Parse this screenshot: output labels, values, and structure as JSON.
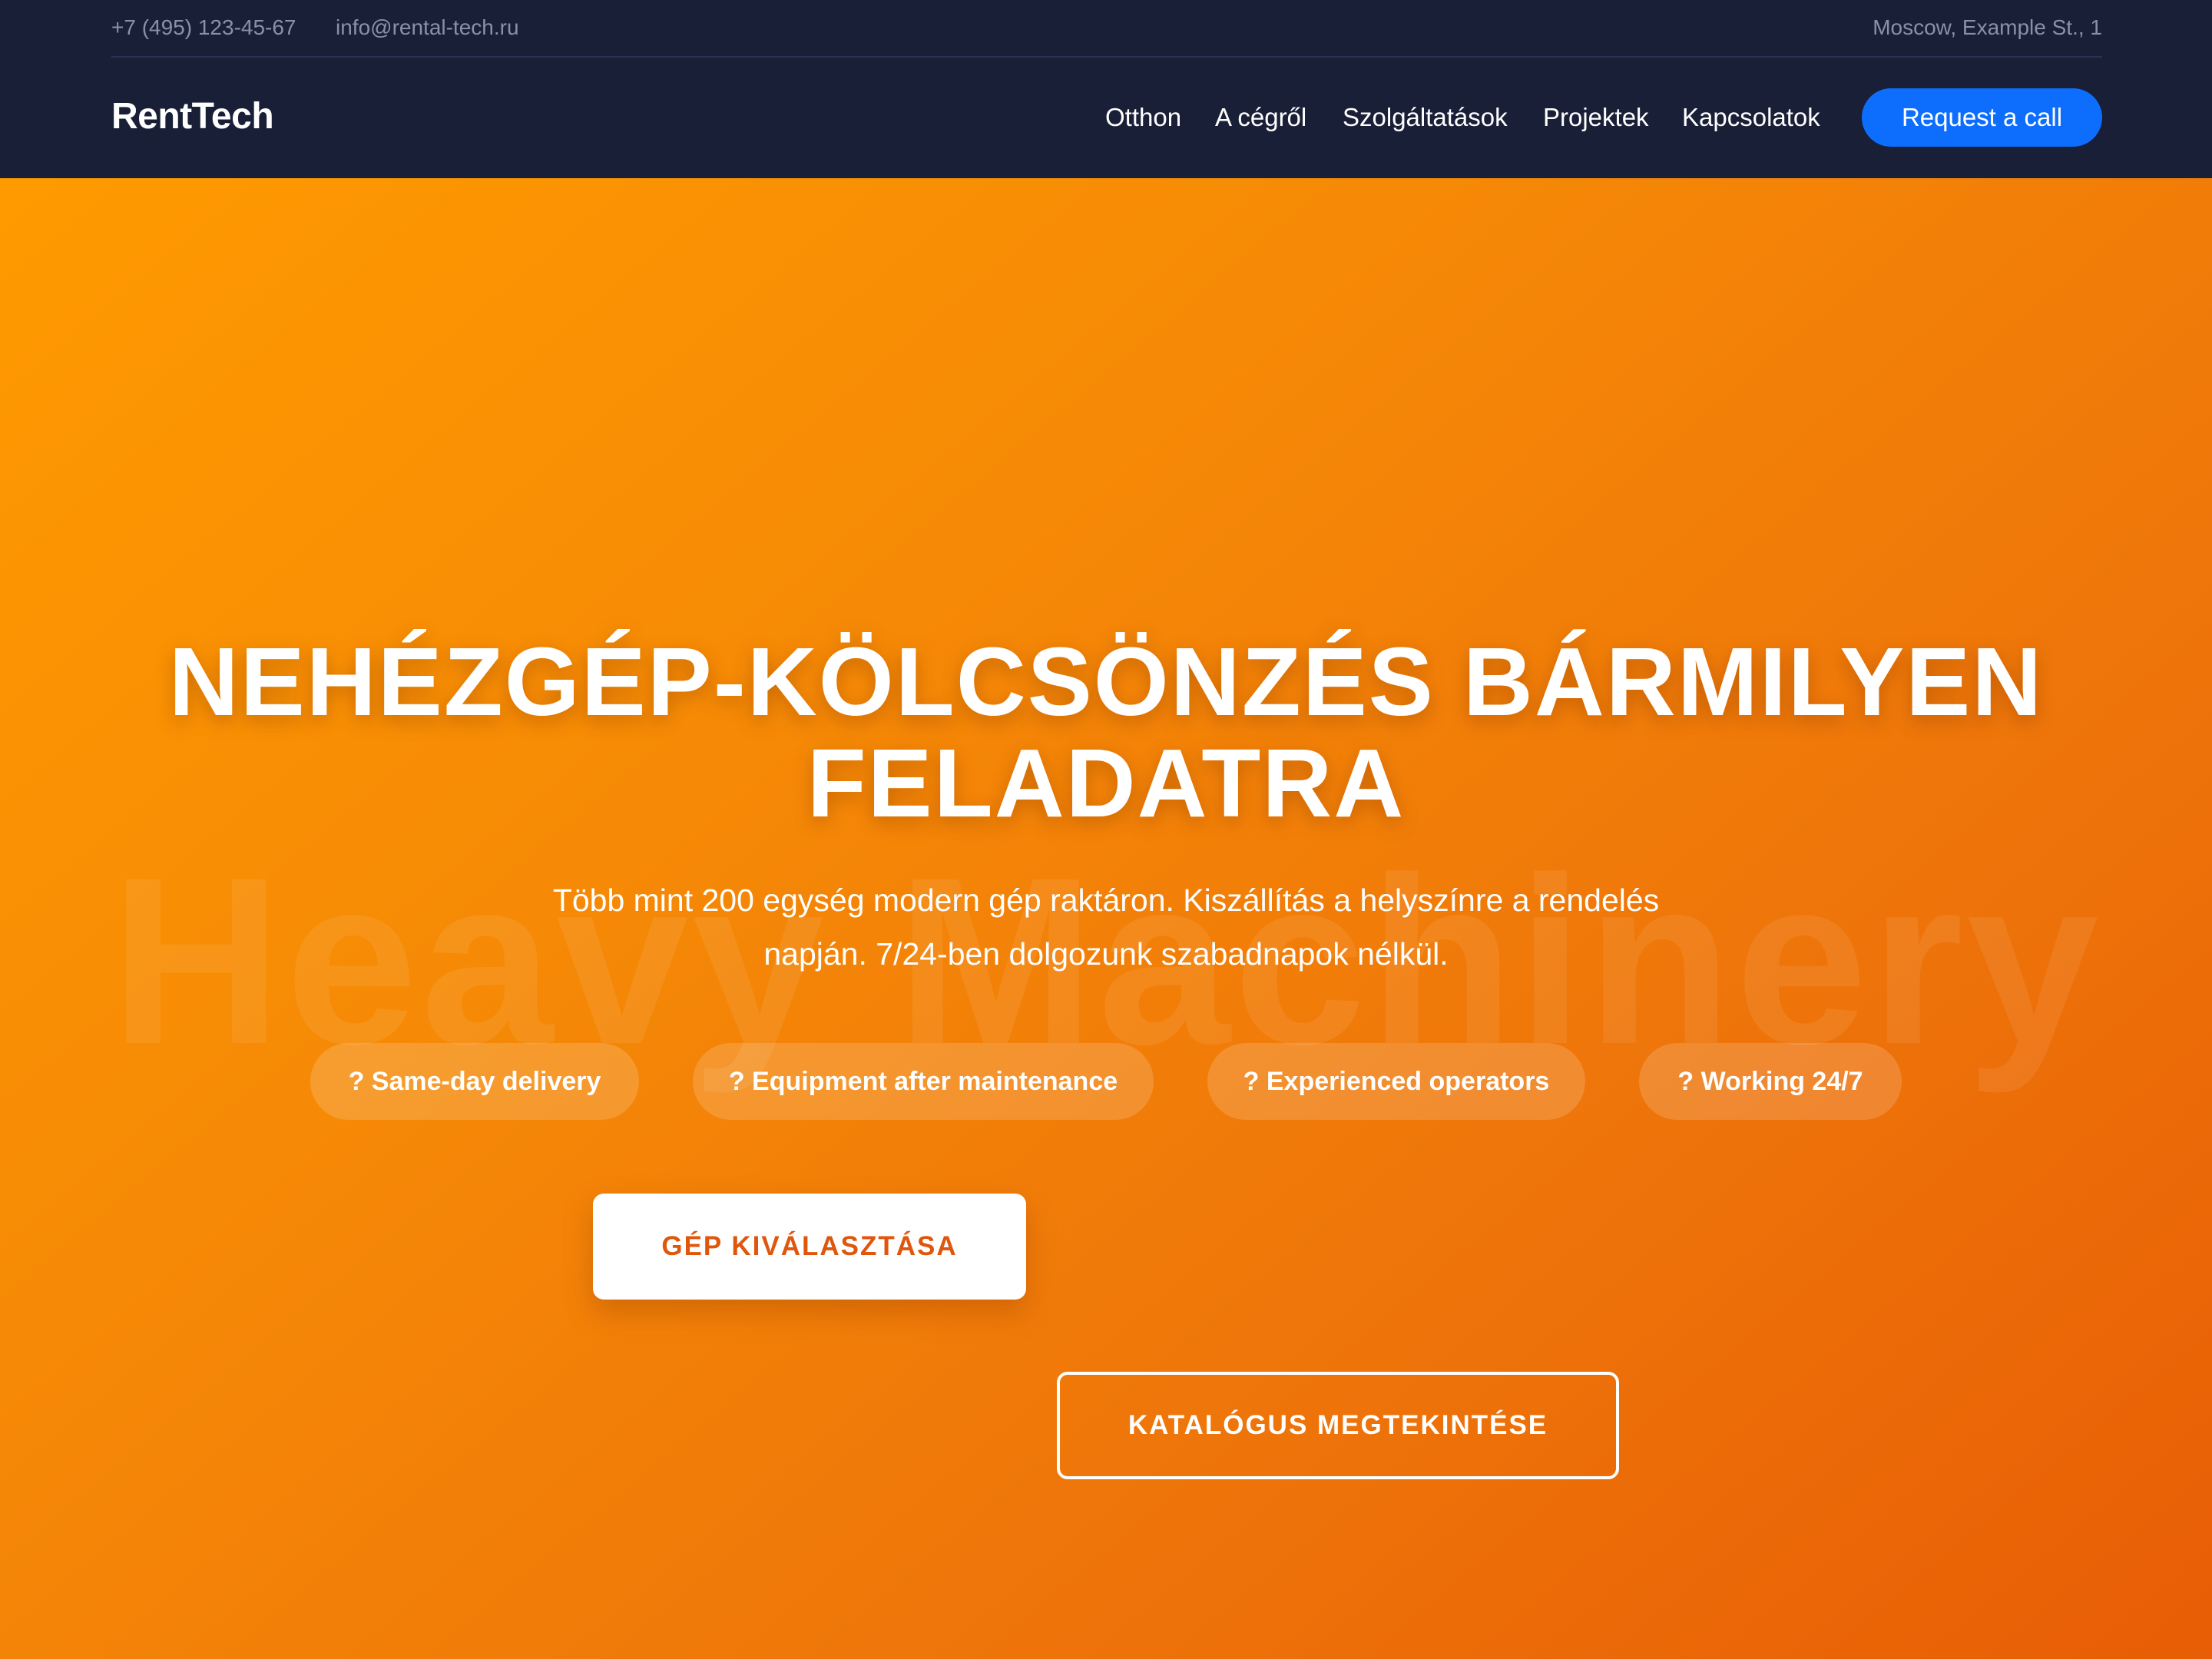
{
  "topbar": {
    "phone": "+7 (495) 123-45-67",
    "email": "info@rental-tech.ru",
    "address": "Moscow, Example St., 1"
  },
  "header": {
    "logo": "RentTech",
    "nav": {
      "home": "Otthon",
      "about": "A cégről",
      "services": "Szolgáltatások",
      "projects": "Projektek",
      "contacts": "Kapcsolatok"
    },
    "cta_label": "Request a call"
  },
  "hero": {
    "watermark": "Heavy Machinery",
    "title_line1": "NEHÉZGÉP-KÖLCSÖNZÉS BÁRMILYEN",
    "title_line2": "FELADATRA",
    "subtitle_line1": "Több mint 200 egység modern gép raktáron. Kiszállítás a helyszínre a rendelés",
    "subtitle_line2": "napján. 7/24-ben dolgozunk szabadnapok nélkül.",
    "features": [
      "? Same-day delivery",
      "? Equipment after maintenance",
      "? Experienced operators",
      "? Working 24/7"
    ],
    "primary_button": "GÉP KIVÁLASZTÁSA",
    "secondary_button": "KATALÓGUS MEGTEKINTÉSE"
  },
  "colors": {
    "header_bg": "#1a1f38",
    "accent_blue": "#0d6efd",
    "hero_orange_start": "#ff9a00",
    "hero_orange_end": "#e85d05",
    "primary_button_text": "#e0560c"
  }
}
